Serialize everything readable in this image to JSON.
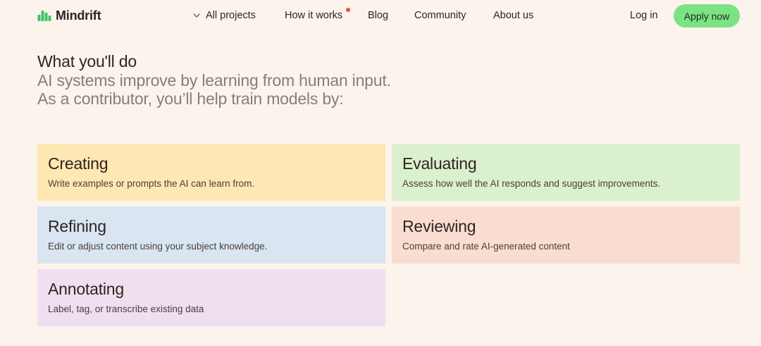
{
  "brand": {
    "name": "Mindrift",
    "logo_icon": "bars-logo-icon",
    "accent_color": "#7ce383"
  },
  "nav": {
    "projects_label": "All projects",
    "how_label": "How it works",
    "blog_label": "Blog",
    "community_label": "Community",
    "about_label": "About us",
    "login_label": "Log in",
    "apply_label": "Apply now",
    "notification_color": "#e8543a"
  },
  "intro": {
    "title": "What you'll do",
    "line1": "AI systems improve by learning from human input.",
    "line2": "As a contributor, you’ll help train models by:"
  },
  "cards": [
    {
      "title": "Creating",
      "desc": "Write examples or prompts the AI can learn from.",
      "color": "#fde7b2"
    },
    {
      "title": "Evaluating",
      "desc": "Assess how well the AI responds and suggest improvements.",
      "color": "#dbf0cd"
    },
    {
      "title": "Refining",
      "desc": "Edit or adjust content using your subject knowledge.",
      "color": "#d9e6f2"
    },
    {
      "title": "Reviewing",
      "desc": "Compare and rate AI-generated content",
      "color": "#f9ddd0"
    },
    {
      "title": "Annotating",
      "desc": "Label, tag, or transcribe existing data",
      "color": "#eee0ee"
    }
  ]
}
